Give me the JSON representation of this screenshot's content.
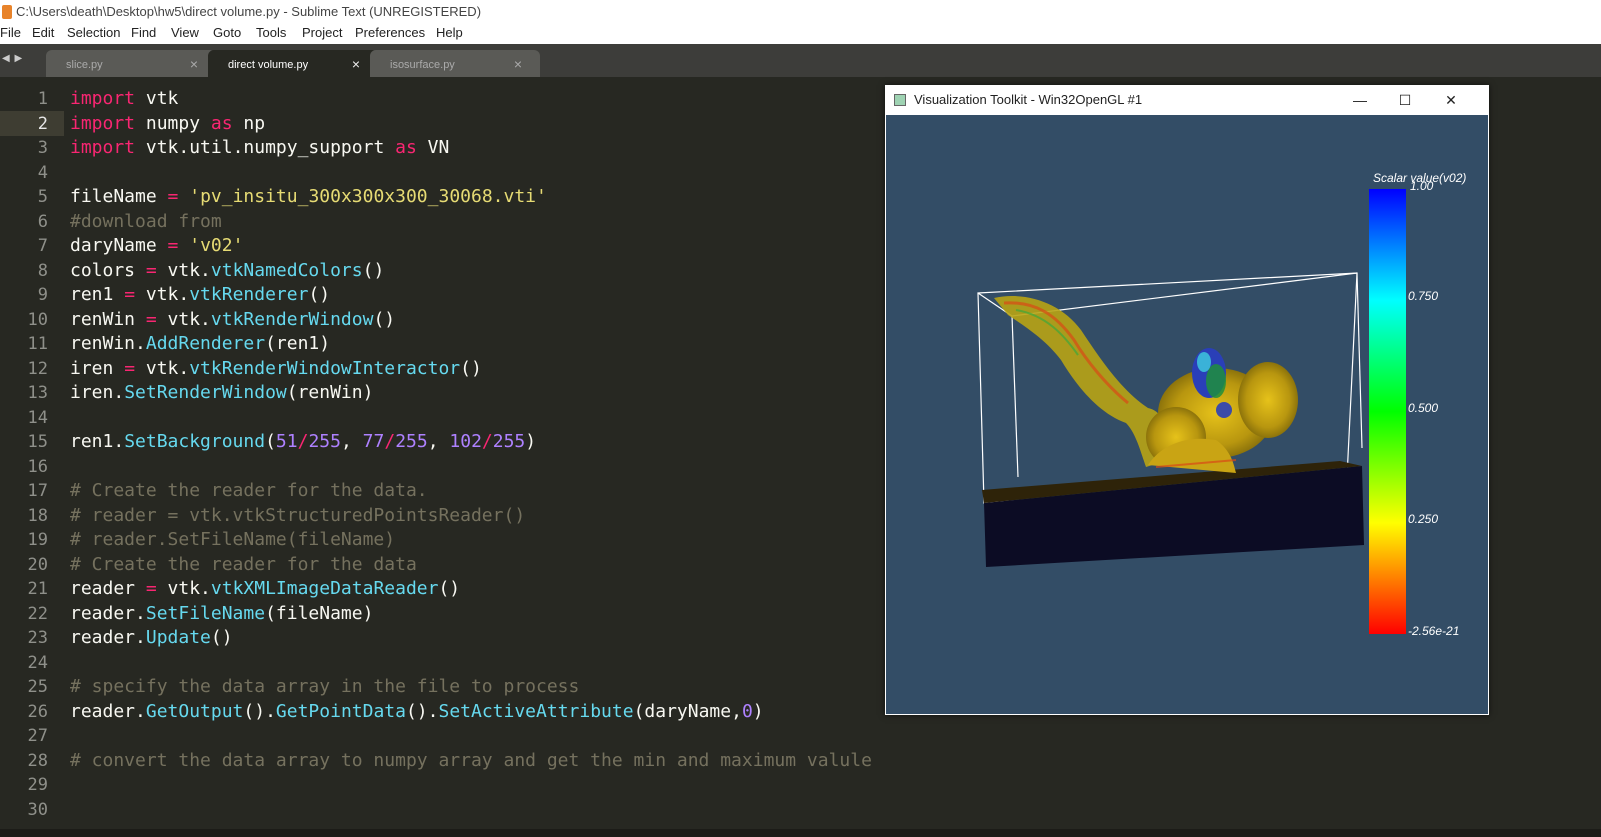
{
  "window": {
    "title": "C:\\Users\\death\\Desktop\\hw5\\direct volume.py - Sublime Text (UNREGISTERED)"
  },
  "menu": [
    "File",
    "Edit",
    "Selection",
    "Find",
    "View",
    "Goto",
    "Tools",
    "Project",
    "Preferences",
    "Help"
  ],
  "tabs": [
    {
      "label": "slice.py",
      "active": false
    },
    {
      "label": "direct volume.py",
      "active": true
    },
    {
      "label": "isosurface.py",
      "active": false
    }
  ],
  "tab_nav": "◀ ▶",
  "tab_close_glyph": "×",
  "current_line": 2,
  "code_lines": [
    [
      [
        "kw",
        "import"
      ],
      [
        "t",
        " vtk"
      ]
    ],
    [
      [
        "kw",
        "import"
      ],
      [
        "t",
        " numpy "
      ],
      [
        "kw",
        "as"
      ],
      [
        "t",
        " np"
      ]
    ],
    [
      [
        "kw",
        "import"
      ],
      [
        "t",
        " vtk.util.numpy_support "
      ],
      [
        "kw",
        "as"
      ],
      [
        "t",
        " VN"
      ]
    ],
    [],
    [
      [
        "t",
        "fileName "
      ],
      [
        "kw",
        "="
      ],
      [
        "t",
        " "
      ],
      [
        "str",
        "'pv_insitu_300x300x300_30068.vti'"
      ]
    ],
    [
      [
        "cm",
        "#download from"
      ]
    ],
    [
      [
        "t",
        "daryName "
      ],
      [
        "kw",
        "="
      ],
      [
        "t",
        " "
      ],
      [
        "str",
        "'v02'"
      ]
    ],
    [
      [
        "t",
        "colors "
      ],
      [
        "kw",
        "="
      ],
      [
        "t",
        " vtk."
      ],
      [
        "fn",
        "vtkNamedColors"
      ],
      [
        "t",
        "()"
      ]
    ],
    [
      [
        "t",
        "ren1 "
      ],
      [
        "kw",
        "="
      ],
      [
        "t",
        " vtk."
      ],
      [
        "fn",
        "vtkRenderer"
      ],
      [
        "t",
        "()"
      ]
    ],
    [
      [
        "t",
        "renWin "
      ],
      [
        "kw",
        "="
      ],
      [
        "t",
        " vtk."
      ],
      [
        "fn",
        "vtkRenderWindow"
      ],
      [
        "t",
        "()"
      ]
    ],
    [
      [
        "t",
        "renWin."
      ],
      [
        "fn",
        "AddRenderer"
      ],
      [
        "t",
        "(ren1)"
      ]
    ],
    [
      [
        "t",
        "iren "
      ],
      [
        "kw",
        "="
      ],
      [
        "t",
        " vtk."
      ],
      [
        "fn",
        "vtkRenderWindowInteractor"
      ],
      [
        "t",
        "()"
      ]
    ],
    [
      [
        "t",
        "iren."
      ],
      [
        "fn",
        "SetRenderWindow"
      ],
      [
        "t",
        "(renWin)"
      ]
    ],
    [],
    [
      [
        "t",
        "ren1."
      ],
      [
        "fn",
        "SetBackground"
      ],
      [
        "t",
        "("
      ],
      [
        "num",
        "51"
      ],
      [
        "kw",
        "/"
      ],
      [
        "num",
        "255"
      ],
      [
        "t",
        ", "
      ],
      [
        "num",
        "77"
      ],
      [
        "kw",
        "/"
      ],
      [
        "num",
        "255"
      ],
      [
        "t",
        ", "
      ],
      [
        "num",
        "102"
      ],
      [
        "kw",
        "/"
      ],
      [
        "num",
        "255"
      ],
      [
        "t",
        ")"
      ]
    ],
    [],
    [
      [
        "cm",
        "# Create the reader for the data."
      ]
    ],
    [
      [
        "cm",
        "# reader = vtk.vtkStructuredPointsReader()"
      ]
    ],
    [
      [
        "cm",
        "# reader.SetFileName(fileName)"
      ]
    ],
    [
      [
        "cm",
        "# Create the reader for the data"
      ]
    ],
    [
      [
        "t",
        "reader "
      ],
      [
        "kw",
        "="
      ],
      [
        "t",
        " vtk."
      ],
      [
        "fn",
        "vtkXMLImageDataReader"
      ],
      [
        "t",
        "()"
      ]
    ],
    [
      [
        "t",
        "reader."
      ],
      [
        "fn",
        "SetFileName"
      ],
      [
        "t",
        "(fileName)"
      ]
    ],
    [
      [
        "t",
        "reader."
      ],
      [
        "fn",
        "Update"
      ],
      [
        "t",
        "()"
      ]
    ],
    [],
    [
      [
        "cm",
        "# specify the data array in the file to process"
      ]
    ],
    [
      [
        "t",
        "reader."
      ],
      [
        "fn",
        "GetOutput"
      ],
      [
        "t",
        "()."
      ],
      [
        "fn",
        "GetPointData"
      ],
      [
        "t",
        "()."
      ],
      [
        "fn",
        "SetActiveAttribute"
      ],
      [
        "t",
        "(daryName,"
      ],
      [
        "num",
        "0"
      ],
      [
        "t",
        ")"
      ]
    ],
    [],
    [
      [
        "cm",
        "# convert the data array to numpy array and get the min and maximum valule"
      ]
    ],
    [],
    []
  ],
  "colors": {
    "keyword": "#f92672",
    "string": "#e6db74",
    "function": "#66d9ef",
    "number": "#ae81ff",
    "comment": "#75715e",
    "text": "#f8f8f2"
  },
  "vtk_window": {
    "title": "Visualization Toolkit - Win32OpenGL #1",
    "min_glyph": "—",
    "max_glyph": "☐",
    "close_glyph": "✕",
    "background": "#334d66",
    "scalar_bar": {
      "title": "Scalar value(v02)",
      "labels": [
        "1.00",
        "0.750",
        "0.500",
        "0.250",
        "-2.56e-21"
      ]
    }
  }
}
